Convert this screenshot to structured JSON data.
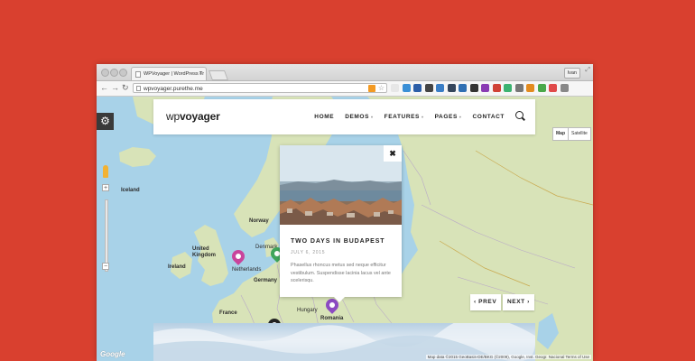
{
  "browser": {
    "tab_title": "WPVoyager | WordPress Tr",
    "url": "wpvoyager.purethe.me",
    "user_button": "Ivan",
    "extensions": [
      "#e7e7e7",
      "#3a8fd6",
      "#2b5ea8",
      "#444444",
      "#3a7ec6",
      "#35465c",
      "#2f6fb3",
      "#333333",
      "#8a3bb3",
      "#d04236",
      "#3cb371",
      "#777777",
      "#e38b1f",
      "#4aa84a",
      "#e04a4a",
      "#888888"
    ]
  },
  "site": {
    "logo_wp": "wp",
    "logo_voyager": "voyager",
    "nav": [
      {
        "label": "HOME",
        "caret": false
      },
      {
        "label": "DEMOS",
        "caret": true
      },
      {
        "label": "FEATURES",
        "caret": true
      },
      {
        "label": "PAGES",
        "caret": true
      },
      {
        "label": "CONTACT",
        "caret": false
      }
    ]
  },
  "map": {
    "type_controls": [
      "Map",
      "Satellite"
    ],
    "labels": {
      "iceland": "Iceland",
      "norway": "Norway",
      "denmark": "Denmark",
      "united_kingdom": "United Kingdom",
      "ireland": "Ireland",
      "netherlands": "Netherlands",
      "germany": "Germany",
      "france": "France",
      "hungary": "Hungary",
      "romania": "Romania"
    },
    "footer": "Map data ©2015 GeoBasis-DE/BKG (©2009), Google, Inst. Geogr. Nacional   Terms of Use",
    "google": "Google",
    "marker_colors": {
      "pink": "#c9449c",
      "green": "#3fa55b",
      "purple": "#8c4ac2",
      "dark": "#222222"
    }
  },
  "popup": {
    "title": "TWO DAYS IN BUDAPEST",
    "date": "JULY 6, 2015",
    "excerpt": "Phasellus rhoncus metus sed neque efficitur vestibulum. Suspendisse lacinia lacus vel ante scelerisqu."
  },
  "pager": {
    "prev": "PREV",
    "next": "NEXT"
  },
  "colors": {
    "background": "#d9402f",
    "water": "#a8d2e8",
    "land": "#d8e3b8"
  }
}
